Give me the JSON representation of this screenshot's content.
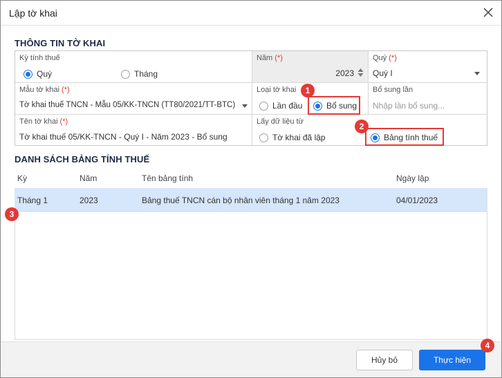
{
  "dialog": {
    "title": "Lập tờ khai"
  },
  "sections": {
    "info": "THÔNG TIN TỜ KHAI",
    "list": "DANH SÁCH BẢNG TÍNH THUẾ"
  },
  "form": {
    "ky_tinh_thue": {
      "label": "Kỳ tính thuế",
      "options": [
        "Quý",
        "Tháng"
      ],
      "selected": "Quý"
    },
    "nam": {
      "label": "Năm",
      "required": "(*)",
      "value": "2023"
    },
    "quy": {
      "label": "Quý",
      "required": "(*)",
      "value": "Quý I"
    },
    "mau_to_khai": {
      "label": "Mẫu tờ khai",
      "required": "(*)",
      "value": "Tờ khai thuế TNCN - Mẫu 05/KK-TNCN (TT80/2021/TT-BTC)"
    },
    "loai_to_khai": {
      "label": "Loại tờ khai",
      "options": [
        "Lần đầu",
        "Bổ sung"
      ],
      "selected": "Bổ sung"
    },
    "bo_sung_lan": {
      "label": "Bổ sung lần",
      "placeholder": "Nhập lần bổ sung..."
    },
    "ten_to_khai": {
      "label": "Tên tờ khai",
      "required": "(*)",
      "value": "Tờ khai thuế 05/KK-TNCN - Quý I - Năm 2023 - Bổ sung"
    },
    "lay_du_lieu_tu": {
      "label": "Lấy dữ liệu từ",
      "options": [
        "Tờ khai đã lập",
        "Bảng tính thuế"
      ],
      "selected": "Bảng tính thuế"
    }
  },
  "table": {
    "columns": [
      "Kỳ",
      "Năm",
      "Tên bảng tính",
      "Ngày lập"
    ],
    "rows": [
      {
        "ky": "Tháng 1",
        "nam": "2023",
        "ten": "Bảng thuế TNCN cán bộ nhân viên tháng 1 năm 2023",
        "ngay": "04/01/2023"
      }
    ]
  },
  "badges": [
    "1",
    "2",
    "3",
    "4"
  ],
  "footer": {
    "cancel_label": "Hủy bỏ",
    "ok_label": "Thực hiện"
  },
  "colors": {
    "accent": "#1a73e8",
    "highlight": "#e53935",
    "selected_row": "#d6e6fb",
    "footer_bg": "#f2f2f2"
  },
  "icons": {
    "close": "close-icon",
    "spinner": "spinner-arrows-icon",
    "dropdown": "chevron-down-icon"
  }
}
